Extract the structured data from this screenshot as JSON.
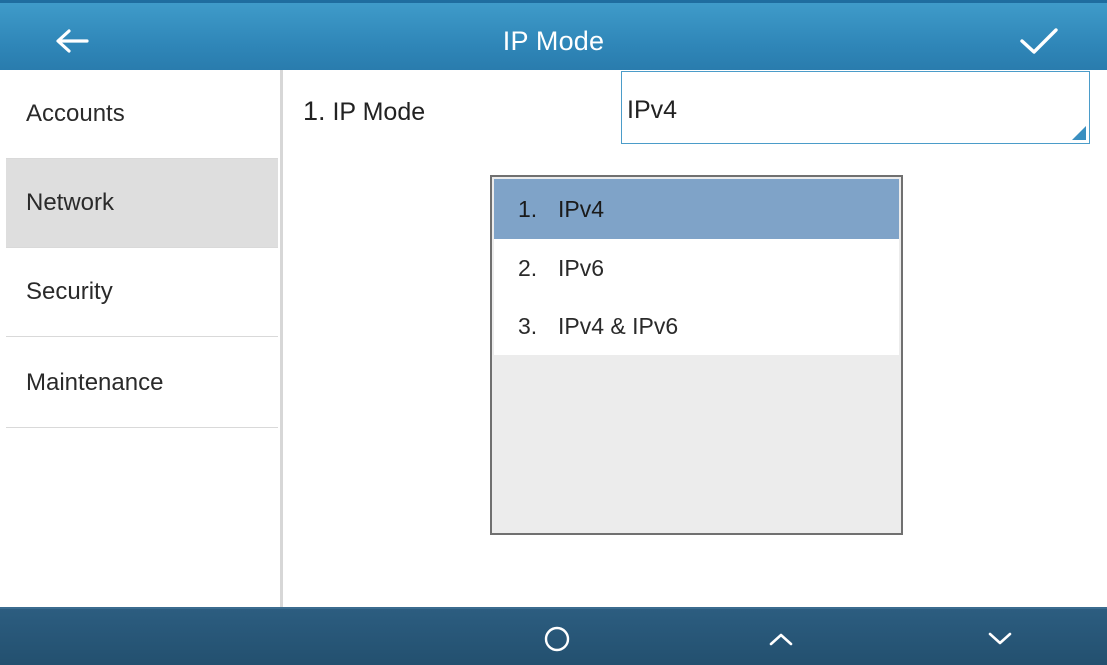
{
  "header": {
    "title": "IP Mode",
    "back_icon": "arrow-left-icon",
    "confirm_icon": "checkmark-icon"
  },
  "sidebar": {
    "items": [
      {
        "label": "Accounts",
        "active": false
      },
      {
        "label": "Network",
        "active": true
      },
      {
        "label": "Security",
        "active": false
      },
      {
        "label": "Maintenance",
        "active": false
      }
    ]
  },
  "field": {
    "number": "1.",
    "label": "IP Mode",
    "value": "IPv4"
  },
  "dropdown": {
    "options": [
      {
        "number": "1.",
        "label": "IPv4",
        "selected": true
      },
      {
        "number": "2.",
        "label": "IPv6",
        "selected": false
      },
      {
        "number": "3.",
        "label": "IPv4 & IPv6",
        "selected": false
      }
    ]
  },
  "footer": {
    "buttons": [
      {
        "icon": "circle-icon"
      },
      {
        "icon": "chevron-up-icon"
      },
      {
        "icon": "chevron-down-icon"
      }
    ]
  },
  "colors": {
    "header": "#2f86b8",
    "footer": "#25526f",
    "selected_option": "#7fa3c8",
    "active_sidebar": "#dedede"
  }
}
